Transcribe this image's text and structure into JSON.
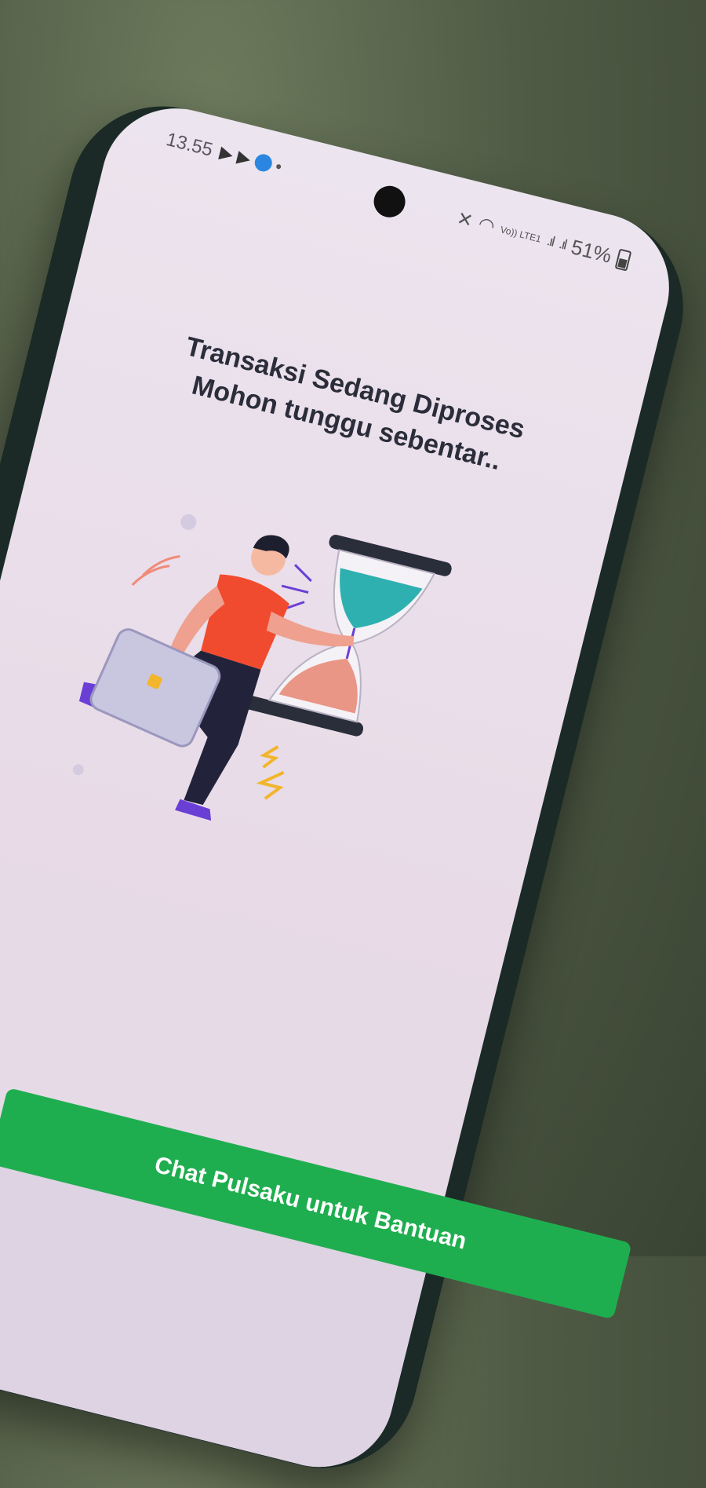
{
  "status_bar": {
    "time": "13.55",
    "signal_label": "Vo)) LTE1",
    "battery_percent": "51%"
  },
  "screen": {
    "title_line1": "Transaksi Sedang Diproses",
    "title_line2": "Mohon tunggu sebentar.."
  },
  "help_button": {
    "label": "Chat Pulsaku untuk Bantuan"
  },
  "colors": {
    "button_green": "#1fae4f",
    "shirt_red": "#f14b2f",
    "sand_teal": "#2fb0b0",
    "sand_peach": "#e99686",
    "shoe_purple": "#6a3fd6"
  },
  "icons": [
    "mute-icon",
    "wifi-icon",
    "signal-icon",
    "battery-icon",
    "hourglass-icon",
    "briefcase-icon"
  ]
}
